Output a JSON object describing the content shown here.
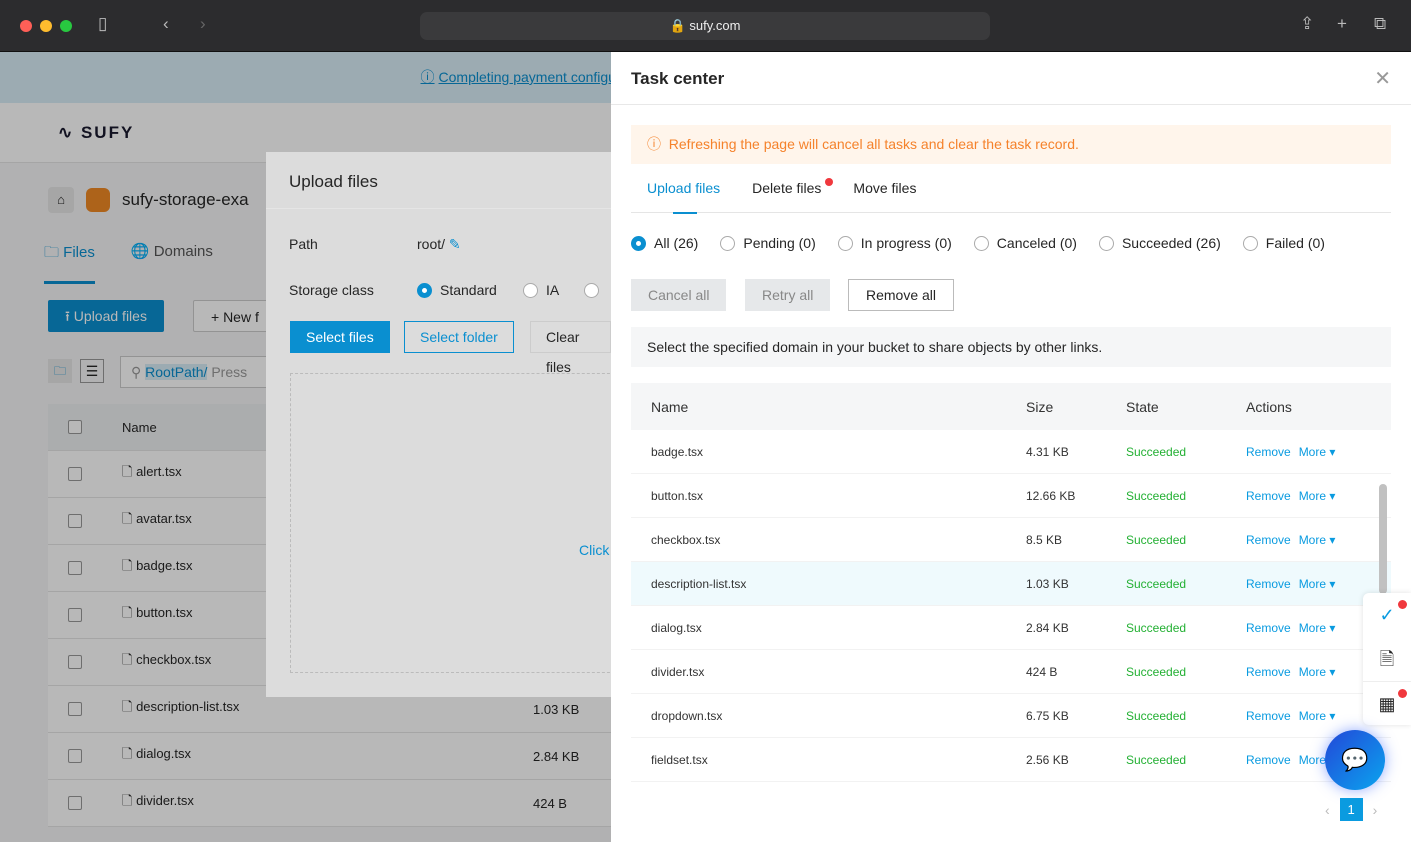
{
  "browser": {
    "url": "sufy.com"
  },
  "page": {
    "banner": "Completing payment configuration",
    "logo": "SUFY",
    "bucket": "sufy-storage-exa",
    "tabs": [
      "Files",
      "Domains"
    ],
    "upload_btn": "Upload files",
    "new_btn": "+ New f",
    "search_prefix": "RootPath/",
    "search_placeholder": "Press",
    "col_name": "Name",
    "rows": [
      {
        "name": "alert.tsx",
        "size": ""
      },
      {
        "name": "avatar.tsx",
        "size": ""
      },
      {
        "name": "badge.tsx",
        "size": ""
      },
      {
        "name": "button.tsx",
        "size": ""
      },
      {
        "name": "checkbox.tsx",
        "size": ""
      },
      {
        "name": "description-list.tsx",
        "size": "1.03 KB"
      },
      {
        "name": "dialog.tsx",
        "size": "2.84 KB"
      },
      {
        "name": "divider.tsx",
        "size": "424 B"
      }
    ]
  },
  "modal": {
    "title": "Upload files",
    "path_label": "Path",
    "path_value": "root/",
    "storage_label": "Storage class",
    "storage_options": [
      "Standard",
      "IA"
    ],
    "select_files": "Select files",
    "select_folder": "Select folder",
    "clear_files": "Clear files",
    "drop_text": "Click"
  },
  "drawer": {
    "title": "Task center",
    "alert": "Refreshing the page will cancel all tasks and clear the task record.",
    "tabs": [
      "Upload files",
      "Delete files",
      "Move files"
    ],
    "filters": [
      "All (26)",
      "Pending (0)",
      "In progress (0)",
      "Canceled (0)",
      "Succeeded (26)",
      "Failed (0)"
    ],
    "cancel_all": "Cancel all",
    "retry_all": "Retry all",
    "remove_all": "Remove all",
    "info": "Select the specified domain in your bucket to share objects by other links.",
    "columns": [
      "Name",
      "Size",
      "State",
      "Actions"
    ],
    "remove": "Remove",
    "more": "More",
    "rows": [
      {
        "name": "badge.tsx",
        "size": "4.31 KB",
        "state": "Succeeded"
      },
      {
        "name": "button.tsx",
        "size": "12.66 KB",
        "state": "Succeeded"
      },
      {
        "name": "checkbox.tsx",
        "size": "8.5 KB",
        "state": "Succeeded"
      },
      {
        "name": "description-list.tsx",
        "size": "1.03 KB",
        "state": "Succeeded"
      },
      {
        "name": "dialog.tsx",
        "size": "2.84 KB",
        "state": "Succeeded"
      },
      {
        "name": "divider.tsx",
        "size": "424 B",
        "state": "Succeeded"
      },
      {
        "name": "dropdown.tsx",
        "size": "6.75 KB",
        "state": "Succeeded"
      },
      {
        "name": "fieldset.tsx",
        "size": "2.56 KB",
        "state": "Succeeded"
      }
    ],
    "page": "1"
  },
  "colors": {
    "accent": "#0a9be0",
    "success": "#23b033",
    "warning": "#f5822b"
  }
}
